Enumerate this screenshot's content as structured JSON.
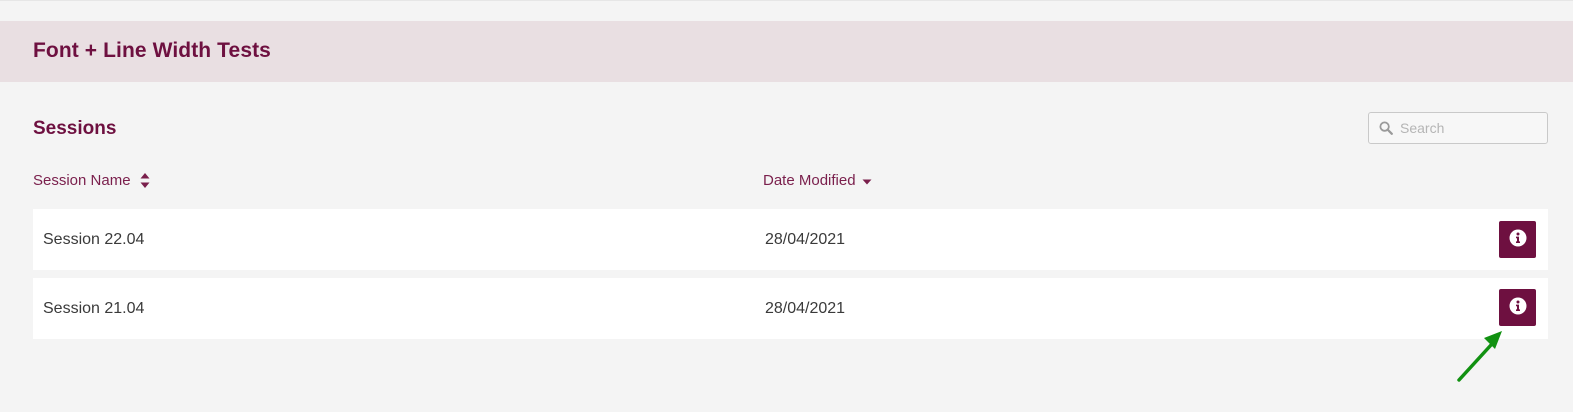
{
  "project": {
    "title": "Font + Line Width Tests"
  },
  "sessions": {
    "title": "Sessions",
    "search": {
      "placeholder": "Search",
      "value": ""
    },
    "columns": {
      "name": "Session Name",
      "date": "Date Modified"
    },
    "rows": [
      {
        "name": "Session 22.04",
        "date": "28/04/2021"
      },
      {
        "name": "Session 21.04",
        "date": "28/04/2021"
      }
    ]
  },
  "icons": {
    "search": "search-icon",
    "sort": "sort-icon",
    "sort_desc": "caret-down-icon",
    "info": "info-icon",
    "annotation": "arrow-annotation"
  },
  "colors": {
    "brand": "#6e1040",
    "header_bg": "#e9dfe2",
    "page_bg": "#f4f4f4",
    "row_bg": "#ffffff",
    "annotation": "#119111"
  }
}
